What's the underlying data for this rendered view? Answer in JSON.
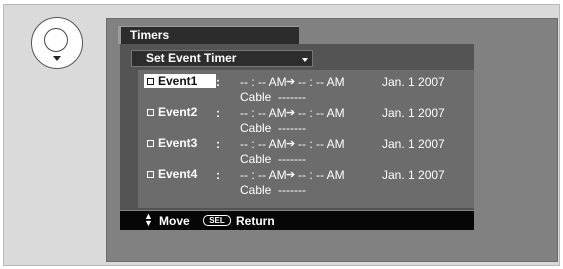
{
  "remote_button": {
    "icon": "select-button-icon"
  },
  "menu": {
    "title": "Timers",
    "dropdown": {
      "label": "Set Event Timer",
      "icon": "dropdown-arrow-icon"
    },
    "events": [
      {
        "label": "Event1",
        "selected": true,
        "colon": ":",
        "start": "-- : -- AM",
        "end": "-- : -- AM",
        "date": "Jan. 1 2007",
        "source": "Cable  -------"
      },
      {
        "label": "Event2",
        "selected": false,
        "colon": ":",
        "start": "-- : -- AM",
        "end": "-- : -- AM",
        "date": "Jan. 1 2007",
        "source": "Cable  -------"
      },
      {
        "label": "Event3",
        "selected": false,
        "colon": ":",
        "start": "-- : -- AM",
        "end": "-- : -- AM",
        "date": "Jan. 1 2007",
        "source": "Cable  -------"
      },
      {
        "label": "Event4",
        "selected": false,
        "colon": ":",
        "start": "-- : -- AM",
        "end": "-- : -- AM",
        "date": "Jan. 1 2007",
        "source": "Cable  -------"
      }
    ],
    "arrow_glyph": "➔",
    "footer": {
      "move_icon": "up-down-arrow-icon",
      "move_label": "Move",
      "sel_icon_text": "SEL",
      "return_label": "Return"
    }
  }
}
